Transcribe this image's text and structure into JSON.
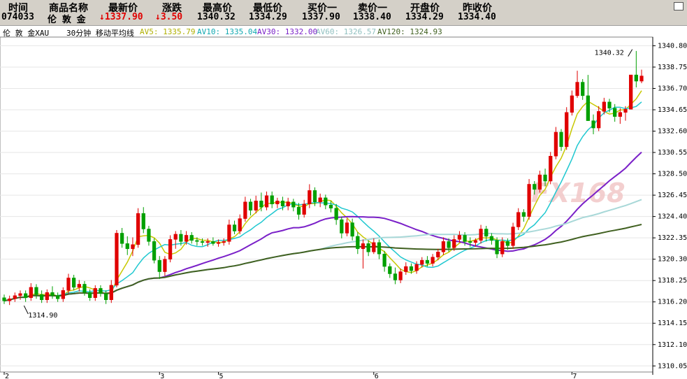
{
  "quote": {
    "headers": [
      "时间",
      "商品名称",
      "最新价",
      "涨跌",
      "最高价",
      "最低价",
      "买价一",
      "卖价一",
      "开盘价",
      "昨收价"
    ],
    "code": "074033",
    "name": "伦 敦 金",
    "latest": "↓1337.90",
    "change": "↓3.50",
    "high": "1340.32",
    "low": "1334.29",
    "bid": "1337.90",
    "ask": "1338.40",
    "open": "1334.29",
    "prev_close": "1334.40"
  },
  "indicator": {
    "symbol": "伦 敦 金XAU",
    "period": "30分钟 移动平均线",
    "ma5": "AV5: 1335.79",
    "ma10": "AV10: 1335.04",
    "ma30": "AV30: 1332.00",
    "ma60": "AV60: 1326.57",
    "ma120": "AV120: 1324.93"
  },
  "colors": {
    "up": "#e00000",
    "down": "#00a000",
    "ma5": "#c8c800",
    "ma10": "#20c8d0",
    "ma30": "#7a20c8",
    "ma60": "#a8d8d8",
    "ma120": "#406020",
    "grid": "#e6e6e6",
    "axis": "#000000"
  },
  "watermark": "FX168",
  "chart_data": {
    "type": "candlestick",
    "ylim": [
      1309.6,
      1341.5
    ],
    "y_ticks": [
      "1340.80",
      "1338.75",
      "1336.70",
      "1334.65",
      "1332.60",
      "1330.55",
      "1328.50",
      "1326.45",
      "1324.40",
      "1322.35",
      "1320.30",
      "1318.25",
      "1316.20",
      "1314.15",
      "1312.10",
      "1310.05"
    ],
    "x_labels": [
      {
        "label": "2",
        "index": 0
      },
      {
        "label": "3",
        "index": 29
      },
      {
        "label": "5",
        "index": 40
      },
      {
        "label": "6",
        "index": 69
      },
      {
        "label": "7",
        "index": 106
      }
    ],
    "annotations": [
      {
        "text": "1314.90",
        "index": 5
      },
      {
        "text": "1340.32",
        "index": 117
      }
    ],
    "candles": [
      [
        1316.6,
        1316.9,
        1316.0,
        1316.3
      ],
      [
        1316.3,
        1316.8,
        1315.9,
        1316.5
      ],
      [
        1316.5,
        1317.1,
        1316.2,
        1316.8
      ],
      [
        1316.8,
        1317.3,
        1316.4,
        1317.0
      ],
      [
        1317.0,
        1317.3,
        1316.2,
        1316.6
      ],
      [
        1316.6,
        1318.0,
        1316.3,
        1317.6
      ],
      [
        1317.6,
        1317.9,
        1316.5,
        1316.9
      ],
      [
        1316.9,
        1317.3,
        1316.1,
        1316.4
      ],
      [
        1316.4,
        1317.4,
        1316.1,
        1317.1
      ],
      [
        1317.1,
        1317.7,
        1316.5,
        1316.8
      ],
      [
        1316.8,
        1317.1,
        1316.2,
        1316.5
      ],
      [
        1316.5,
        1317.6,
        1316.2,
        1317.3
      ],
      [
        1317.3,
        1318.9,
        1317.0,
        1318.5
      ],
      [
        1318.5,
        1318.8,
        1317.3,
        1317.6
      ],
      [
        1317.6,
        1318.3,
        1317.2,
        1317.9
      ],
      [
        1317.9,
        1318.2,
        1316.8,
        1317.1
      ],
      [
        1317.1,
        1317.4,
        1316.3,
        1316.6
      ],
      [
        1316.6,
        1317.8,
        1316.3,
        1317.5
      ],
      [
        1317.5,
        1317.8,
        1316.7,
        1317.0
      ],
      [
        1317.0,
        1317.3,
        1316.0,
        1316.4
      ],
      [
        1316.4,
        1318.3,
        1316.1,
        1317.8
      ],
      [
        1317.8,
        1323.1,
        1317.6,
        1322.8
      ],
      [
        1322.8,
        1323.3,
        1321.4,
        1321.8
      ],
      [
        1321.8,
        1322.5,
        1320.7,
        1321.3
      ],
      [
        1321.3,
        1322.4,
        1320.6,
        1321.7
      ],
      [
        1321.7,
        1325.2,
        1321.4,
        1324.7
      ],
      [
        1324.7,
        1325.3,
        1322.8,
        1323.2
      ],
      [
        1323.2,
        1323.5,
        1321.6,
        1322.0
      ],
      [
        1322.0,
        1322.3,
        1319.9,
        1320.2
      ],
      [
        1320.2,
        1320.6,
        1318.4,
        1319.1
      ],
      [
        1319.1,
        1320.6,
        1318.7,
        1320.3
      ],
      [
        1320.3,
        1322.6,
        1320.0,
        1322.2
      ],
      [
        1322.2,
        1323.0,
        1321.3,
        1322.7
      ],
      [
        1322.7,
        1323.1,
        1321.6,
        1322.0
      ],
      [
        1322.0,
        1323.0,
        1321.7,
        1322.6
      ],
      [
        1322.6,
        1322.9,
        1321.8,
        1322.1
      ],
      [
        1322.1,
        1322.4,
        1321.6,
        1322.0
      ],
      [
        1322.0,
        1322.3,
        1321.6,
        1321.9
      ],
      [
        1321.9,
        1322.3,
        1321.5,
        1322.0
      ],
      [
        1322.0,
        1322.4,
        1321.6,
        1321.8
      ],
      [
        1321.8,
        1322.2,
        1321.5,
        1321.9
      ],
      [
        1321.9,
        1322.3,
        1321.6,
        1322.0
      ],
      [
        1322.0,
        1324.1,
        1321.7,
        1323.6
      ],
      [
        1323.6,
        1324.0,
        1322.7,
        1323.0
      ],
      [
        1323.0,
        1324.6,
        1322.7,
        1324.2
      ],
      [
        1324.2,
        1326.3,
        1323.9,
        1325.8
      ],
      [
        1325.8,
        1326.1,
        1324.5,
        1325.0
      ],
      [
        1325.0,
        1326.4,
        1324.7,
        1325.9
      ],
      [
        1325.9,
        1326.7,
        1324.9,
        1325.3
      ],
      [
        1325.3,
        1326.8,
        1325.0,
        1326.4
      ],
      [
        1326.4,
        1326.8,
        1325.2,
        1325.6
      ],
      [
        1325.6,
        1326.2,
        1325.2,
        1325.9
      ],
      [
        1325.9,
        1326.3,
        1325.0,
        1325.4
      ],
      [
        1325.4,
        1326.2,
        1325.0,
        1325.8
      ],
      [
        1325.8,
        1326.1,
        1324.9,
        1325.3
      ],
      [
        1325.3,
        1325.7,
        1324.1,
        1324.6
      ],
      [
        1324.6,
        1326.0,
        1324.3,
        1325.6
      ],
      [
        1325.6,
        1327.5,
        1325.2,
        1326.9
      ],
      [
        1326.9,
        1327.2,
        1325.4,
        1325.8
      ],
      [
        1325.8,
        1326.6,
        1325.3,
        1326.2
      ],
      [
        1326.2,
        1326.5,
        1325.1,
        1325.5
      ],
      [
        1325.5,
        1325.9,
        1324.8,
        1325.2
      ],
      [
        1325.2,
        1325.6,
        1323.6,
        1324.1
      ],
      [
        1324.1,
        1324.4,
        1322.3,
        1322.8
      ],
      [
        1322.8,
        1324.2,
        1322.5,
        1323.8
      ],
      [
        1323.8,
        1324.2,
        1322.1,
        1322.5
      ],
      [
        1322.5,
        1322.9,
        1320.8,
        1321.3
      ],
      [
        1321.3,
        1322.2,
        1319.4,
        1321.8
      ],
      [
        1321.8,
        1322.1,
        1320.6,
        1321.0
      ],
      [
        1321.0,
        1322.3,
        1320.8,
        1321.9
      ],
      [
        1321.9,
        1322.2,
        1320.3,
        1320.8
      ],
      [
        1320.8,
        1321.1,
        1319.1,
        1319.6
      ],
      [
        1319.6,
        1319.9,
        1318.5,
        1318.9
      ],
      [
        1318.9,
        1319.5,
        1317.9,
        1318.3
      ],
      [
        1318.3,
        1319.4,
        1318.0,
        1319.1
      ],
      [
        1319.1,
        1320.0,
        1318.8,
        1319.6
      ],
      [
        1319.6,
        1319.9,
        1318.9,
        1319.2
      ],
      [
        1319.2,
        1320.1,
        1318.9,
        1319.8
      ],
      [
        1319.8,
        1320.5,
        1319.5,
        1320.2
      ],
      [
        1320.2,
        1320.6,
        1319.6,
        1319.9
      ],
      [
        1319.9,
        1320.8,
        1319.6,
        1320.5
      ],
      [
        1320.5,
        1321.3,
        1320.2,
        1321.0
      ],
      [
        1321.0,
        1322.4,
        1320.7,
        1322.0
      ],
      [
        1322.0,
        1322.3,
        1321.0,
        1321.4
      ],
      [
        1321.4,
        1322.6,
        1321.1,
        1322.2
      ],
      [
        1322.2,
        1323.0,
        1321.9,
        1322.6
      ],
      [
        1322.6,
        1322.9,
        1321.6,
        1322.0
      ],
      [
        1322.0,
        1322.4,
        1321.5,
        1321.9
      ],
      [
        1321.9,
        1322.3,
        1321.5,
        1322.1
      ],
      [
        1322.1,
        1323.6,
        1321.8,
        1323.2
      ],
      [
        1323.2,
        1323.5,
        1322.0,
        1322.5
      ],
      [
        1322.5,
        1322.8,
        1321.7,
        1322.1
      ],
      [
        1322.1,
        1322.4,
        1320.4,
        1320.8
      ],
      [
        1320.8,
        1322.4,
        1320.5,
        1322.0
      ],
      [
        1322.0,
        1322.3,
        1321.2,
        1321.6
      ],
      [
        1321.6,
        1323.8,
        1321.3,
        1323.4
      ],
      [
        1323.4,
        1325.2,
        1323.1,
        1324.8
      ],
      [
        1324.8,
        1325.1,
        1323.9,
        1324.4
      ],
      [
        1324.4,
        1328.0,
        1324.1,
        1327.5
      ],
      [
        1327.5,
        1327.8,
        1326.5,
        1327.0
      ],
      [
        1327.0,
        1328.8,
        1326.7,
        1328.4
      ],
      [
        1328.4,
        1329.0,
        1327.3,
        1327.8
      ],
      [
        1327.8,
        1330.6,
        1327.5,
        1330.2
      ],
      [
        1330.2,
        1333.0,
        1329.9,
        1332.5
      ],
      [
        1332.5,
        1332.8,
        1330.7,
        1331.1
      ],
      [
        1331.1,
        1334.9,
        1330.8,
        1334.4
      ],
      [
        1334.4,
        1336.5,
        1334.1,
        1336.0
      ],
      [
        1336.0,
        1338.4,
        1335.8,
        1337.3
      ],
      [
        1337.3,
        1337.6,
        1335.6,
        1336.0
      ],
      [
        1336.0,
        1338.0,
        1335.0,
        1333.6
      ],
      [
        1333.6,
        1334.2,
        1332.3,
        1332.9
      ],
      [
        1332.9,
        1335.0,
        1332.6,
        1334.5
      ],
      [
        1334.5,
        1335.8,
        1334.2,
        1335.4
      ],
      [
        1335.4,
        1335.7,
        1334.4,
        1334.8
      ],
      [
        1334.8,
        1335.2,
        1333.5,
        1334.0
      ],
      [
        1334.0,
        1334.8,
        1333.3,
        1334.4
      ],
      [
        1334.4,
        1335.0,
        1333.6,
        1334.7
      ],
      [
        1334.7,
        1338.0,
        1336.4,
        1338.0
      ],
      [
        1338.0,
        1340.3,
        1336.8,
        1337.4
      ],
      [
        1337.4,
        1338.5,
        1337.2,
        1337.9
      ]
    ]
  }
}
